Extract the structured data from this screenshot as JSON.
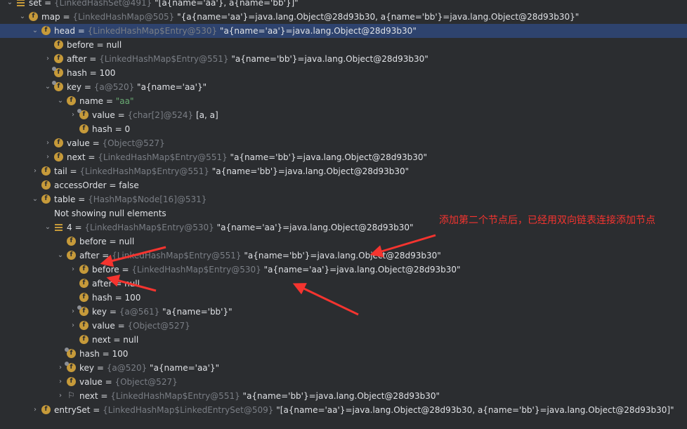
{
  "rows": [
    {
      "depth": 0,
      "expand": "down",
      "icon": "list",
      "name": "set",
      "type": "{LinkedHashSet@491}",
      "value": " \"[a{name='aa'}, a{name='bb'}]\""
    },
    {
      "depth": 1,
      "expand": "down",
      "icon": "f",
      "name": "map",
      "type": "{LinkedHashMap@505}",
      "value": " \"{a{name='aa'}=java.lang.Object@28d93b30, a{name='bb'}=java.lang.Object@28d93b30}\""
    },
    {
      "depth": 2,
      "expand": "down",
      "icon": "f",
      "name": "head",
      "type": "{LinkedHashMap$Entry@530}",
      "value": " \"a{name='aa'}=java.lang.Object@28d93b30\"",
      "selected": true
    },
    {
      "depth": 3,
      "expand": "",
      "icon": "f",
      "name": "before",
      "type": "",
      "value": "null"
    },
    {
      "depth": 3,
      "expand": "right",
      "icon": "f",
      "name": "after",
      "type": "{LinkedHashMap$Entry@551}",
      "value": " \"a{name='bb'}=java.lang.Object@28d93b30\""
    },
    {
      "depth": 3,
      "expand": "",
      "icon": "f-lock",
      "name": "hash",
      "type": "",
      "value": "100"
    },
    {
      "depth": 3,
      "expand": "down",
      "icon": "f-lock",
      "name": "key",
      "type": "{a@520}",
      "value": " \"a{name='aa'}\""
    },
    {
      "depth": 4,
      "expand": "down",
      "icon": "f",
      "name": "name",
      "type": "",
      "value": "\"aa\"",
      "strval": true
    },
    {
      "depth": 5,
      "expand": "right",
      "icon": "f-lock",
      "name": "value",
      "type": "{char[2]@524}",
      "value": " [a, a]"
    },
    {
      "depth": 5,
      "expand": "",
      "icon": "f",
      "name": "hash",
      "type": "",
      "value": "0"
    },
    {
      "depth": 3,
      "expand": "right",
      "icon": "f",
      "name": "value",
      "type": "{Object@527}",
      "value": ""
    },
    {
      "depth": 3,
      "expand": "right",
      "icon": "f",
      "name": "next",
      "type": "{LinkedHashMap$Entry@551}",
      "value": " \"a{name='bb'}=java.lang.Object@28d93b30\""
    },
    {
      "depth": 2,
      "expand": "right",
      "icon": "f",
      "name": "tail",
      "type": "{LinkedHashMap$Entry@551}",
      "value": " \"a{name='bb'}=java.lang.Object@28d93b30\""
    },
    {
      "depth": 2,
      "expand": "",
      "icon": "f",
      "name": "accessOrder",
      "type": "",
      "value": "false"
    },
    {
      "depth": 2,
      "expand": "down",
      "icon": "f",
      "name": "table",
      "type": "{HashMap$Node[16]@531}",
      "value": ""
    },
    {
      "depth": 3,
      "expand": "",
      "icon": "none",
      "plain": "Not showing null elements"
    },
    {
      "depth": 3,
      "expand": "down",
      "icon": "list",
      "name": "4",
      "type": "{LinkedHashMap$Entry@530}",
      "value": " \"a{name='aa'}=java.lang.Object@28d93b30\""
    },
    {
      "depth": 4,
      "expand": "",
      "icon": "f",
      "name": "before",
      "type": "",
      "value": "null"
    },
    {
      "depth": 4,
      "expand": "down",
      "icon": "f",
      "name": "after",
      "type": "{LinkedHashMap$Entry@551}",
      "value": " \"a{name='bb'}=java.lang.Object@28d93b30\""
    },
    {
      "depth": 5,
      "expand": "right",
      "icon": "f",
      "name": "before",
      "type": "{LinkedHashMap$Entry@530}",
      "value": " \"a{name='aa'}=java.lang.Object@28d93b30\""
    },
    {
      "depth": 5,
      "expand": "",
      "icon": "f",
      "name": "after",
      "type": "",
      "value": "null"
    },
    {
      "depth": 5,
      "expand": "",
      "icon": "f",
      "name": "hash",
      "type": "",
      "value": "100"
    },
    {
      "depth": 5,
      "expand": "right",
      "icon": "f-lock",
      "name": "key",
      "type": "{a@561}",
      "value": " \"a{name='bb'}\""
    },
    {
      "depth": 5,
      "expand": "right",
      "icon": "f",
      "name": "value",
      "type": "{Object@527}",
      "value": ""
    },
    {
      "depth": 5,
      "expand": "",
      "icon": "f",
      "name": "next",
      "type": "",
      "value": "null"
    },
    {
      "depth": 4,
      "expand": "",
      "icon": "f-lock",
      "name": "hash",
      "type": "",
      "value": "100"
    },
    {
      "depth": 4,
      "expand": "right",
      "icon": "f-lock",
      "name": "key",
      "type": "{a@520}",
      "value": " \"a{name='aa'}\""
    },
    {
      "depth": 4,
      "expand": "right",
      "icon": "f",
      "name": "value",
      "type": "{Object@527}",
      "value": ""
    },
    {
      "depth": 4,
      "expand": "right",
      "icon": "flag",
      "name": "next",
      "type": "{LinkedHashMap$Entry@551}",
      "value": " \"a{name='bb'}=java.lang.Object@28d93b30\""
    },
    {
      "depth": 2,
      "expand": "right",
      "icon": "f",
      "name": "entrySet",
      "type": "{LinkedHashMap$LinkedEntrySet@509}",
      "value": " \"[a{name='aa'}=java.lang.Object@28d93b30, a{name='bb'}=java.lang.Object@28d93b30]\""
    }
  ],
  "annotation": {
    "text": "添加第二个节点后，已经用双向链表连接添加节点",
    "color": "#f5342f"
  }
}
